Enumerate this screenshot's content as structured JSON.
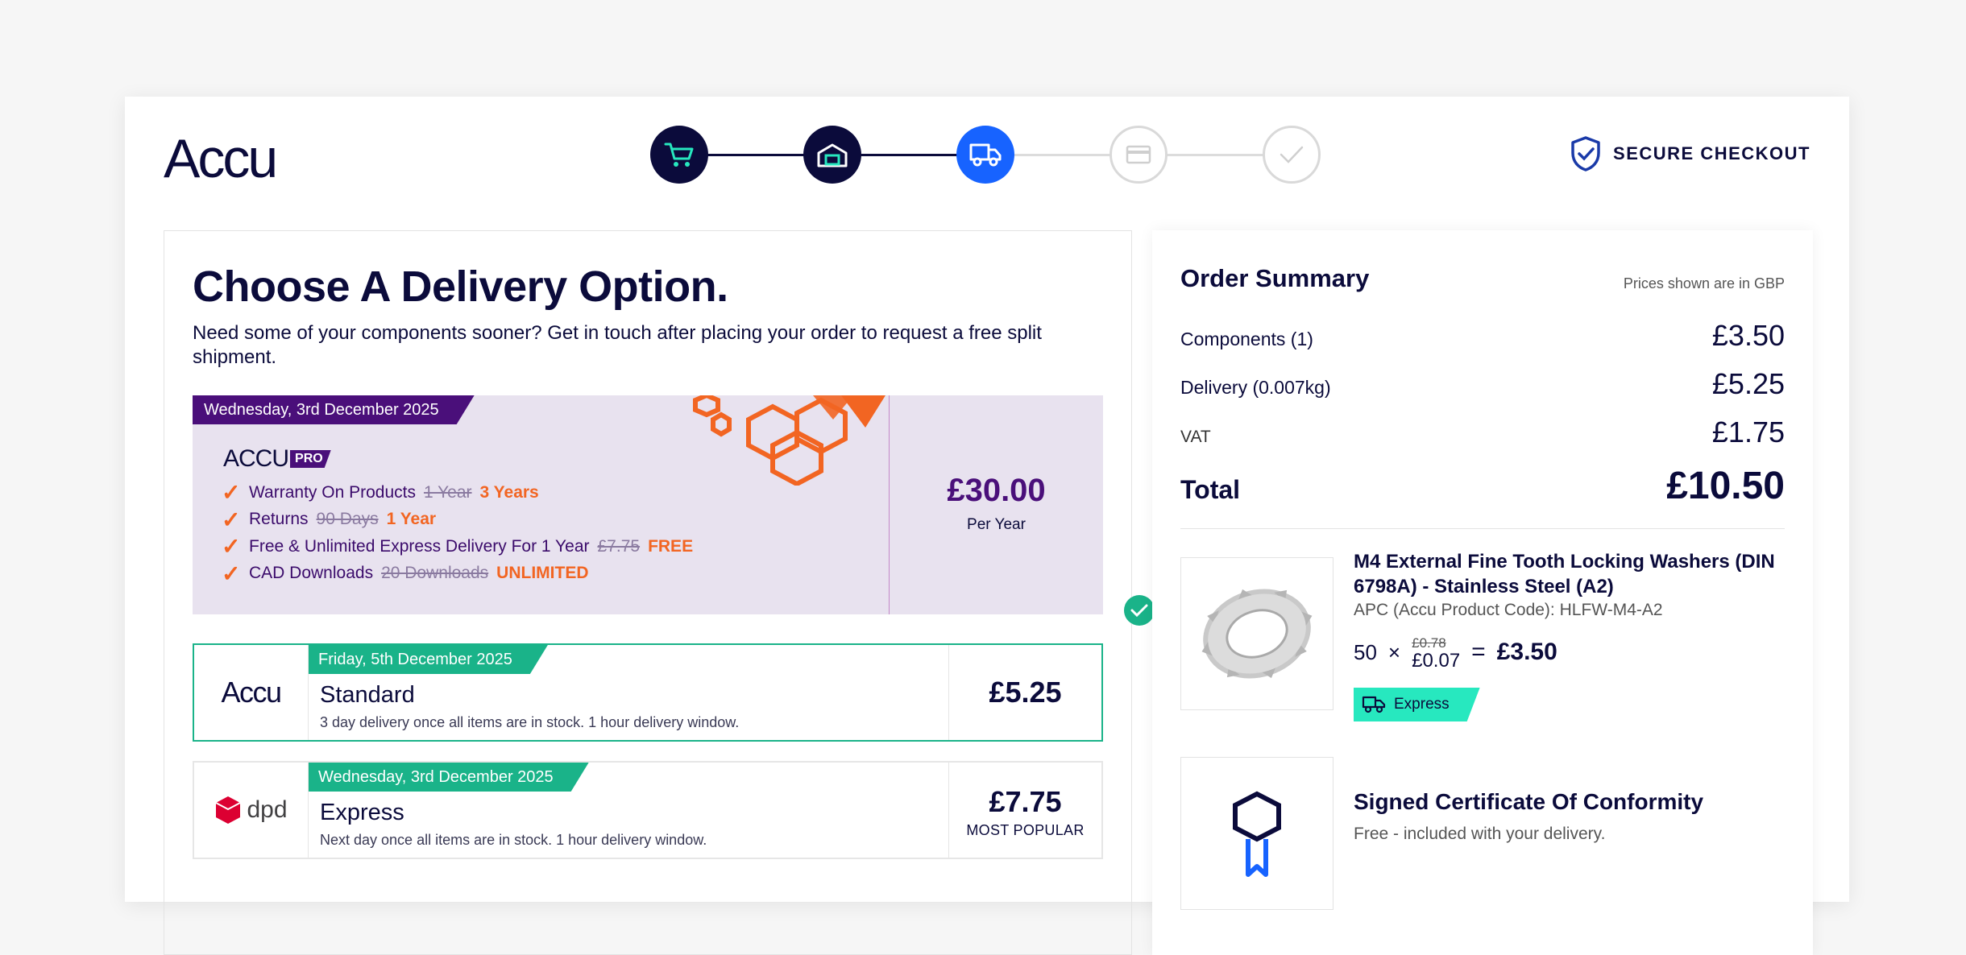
{
  "header": {
    "logo": "Accu",
    "secure_label": "SECURE CHECKOUT",
    "steps": [
      {
        "icon": "cart-icon",
        "state": "done"
      },
      {
        "icon": "warehouse-icon",
        "state": "done"
      },
      {
        "icon": "delivery-truck-icon",
        "state": "active"
      },
      {
        "icon": "payment-card-icon",
        "state": "todo"
      },
      {
        "icon": "check-icon",
        "state": "todo"
      }
    ]
  },
  "delivery": {
    "title": "Choose A Delivery Option.",
    "intro": "Need some of your components sooner? Get in touch after placing your order to request a free split shipment.",
    "pro": {
      "date": "Wednesday, 3rd December 2025",
      "logo_main": "ACCU",
      "logo_badge": "PRO",
      "benefits": [
        {
          "label": "Warranty On Products",
          "old": "1 Year",
          "new": "3 Years"
        },
        {
          "label": "Returns",
          "old": "90 Days",
          "new": "1 Year"
        },
        {
          "label": "Free & Unlimited Express Delivery For 1 Year",
          "old": "£7.75",
          "new": "FREE"
        },
        {
          "label": "CAD Downloads",
          "old": "20 Downloads",
          "new": "UNLIMITED"
        }
      ],
      "price": "£30.00",
      "per": "Per Year"
    },
    "options": [
      {
        "date": "Friday, 5th December 2025",
        "carrier": "Accu",
        "name": "Standard",
        "desc": "3 day delivery once all items are in stock. 1 hour delivery window.",
        "price": "£5.25",
        "badge": "",
        "selected": true
      },
      {
        "date": "Wednesday, 3rd December 2025",
        "carrier": "dpd",
        "name": "Express",
        "desc": "Next day once all items are in stock. 1 hour delivery window.",
        "price": "£7.75",
        "badge": "MOST POPULAR",
        "selected": false
      }
    ]
  },
  "summary": {
    "title": "Order Summary",
    "note": "Prices shown are in GBP",
    "rows": {
      "components": {
        "label": "Components (1)",
        "value": "£3.50"
      },
      "delivery": {
        "label": "Delivery (0.007kg)",
        "value": "£5.25"
      },
      "vat": {
        "label": "VAT",
        "value": "£1.75"
      },
      "total": {
        "label": "Total",
        "value": "£10.50"
      }
    },
    "product": {
      "name": "M4 External Fine Tooth Locking Washers (DIN 6798A) - Stainless Steel (A2)",
      "code": "APC (Accu Product Code): HLFW-M4-A2",
      "qty": "50",
      "times": "×",
      "old_price": "£0.78",
      "new_price": "£0.07",
      "equals": "=",
      "line_total": "£3.50",
      "badge": "Express"
    },
    "certificate": {
      "title": "Signed Certificate Of Conformity",
      "sub": "Free - included with your delivery."
    }
  },
  "colors": {
    "navy": "#0b0b3b",
    "active_step": "#1763ff",
    "green": "#1ab389",
    "purple": "#4a0f7a",
    "orange": "#f26522",
    "express": "#27e8bf"
  }
}
